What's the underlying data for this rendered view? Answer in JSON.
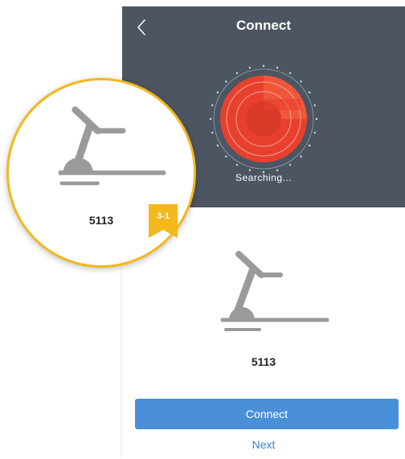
{
  "header": {
    "title": "Connect",
    "status": "Searching..."
  },
  "device_list": {
    "device_name": "5113"
  },
  "actions": {
    "connect_label": "Connect",
    "next_label": "Next"
  },
  "callout": {
    "device_name": "5113",
    "tag_label": "3-1"
  },
  "icons": {
    "back": "chevron-left-icon",
    "device": "treadmill-icon",
    "radar": "radar-icon"
  },
  "colors": {
    "header_bg": "#4d5563",
    "radar_red": "#e8402f",
    "primary_button": "#4a90d8",
    "link": "#3a83c9",
    "callout_border": "#f2b81c"
  }
}
